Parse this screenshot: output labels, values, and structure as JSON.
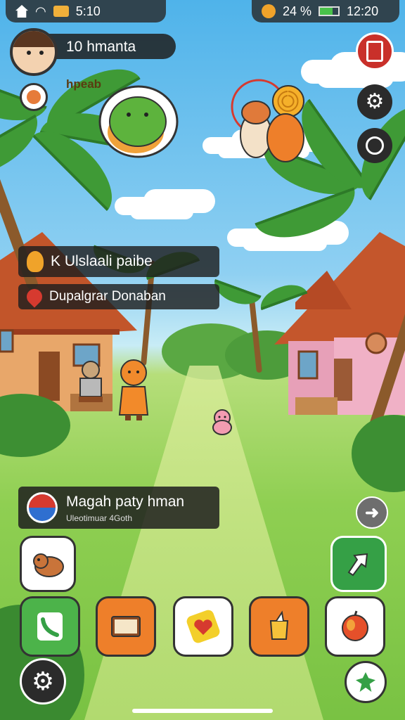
{
  "status_bar": {
    "time_left": "5:10",
    "battery": "24 %",
    "time_right": "12:20"
  },
  "player": {
    "level_text": "10 hmanta",
    "sub_label": "hpeab"
  },
  "quests": [
    {
      "label": "K Ulslaali paibe"
    },
    {
      "label": "Dupalgrar Donaban"
    }
  ],
  "notification": {
    "title": "Magah paty hman",
    "subtitle": "Uleotimuar 4Goth"
  },
  "icons": {
    "settings": "gear-icon",
    "compass": "compass-icon",
    "bag": "bag-icon",
    "phone": "phone-icon",
    "book": "book-icon",
    "heart": "heart-icon",
    "tea": "cup-icon",
    "apple": "apple-icon",
    "leaf": "leaf-icon",
    "next": "arrow-right-icon",
    "map": "map-icon"
  },
  "colors": {
    "hud_dark": "#2b2b2b",
    "accent_orange": "#ee7f2a",
    "accent_green": "#35a046",
    "accent_red": "#d63a2f",
    "level_text": "#f2a03a"
  }
}
